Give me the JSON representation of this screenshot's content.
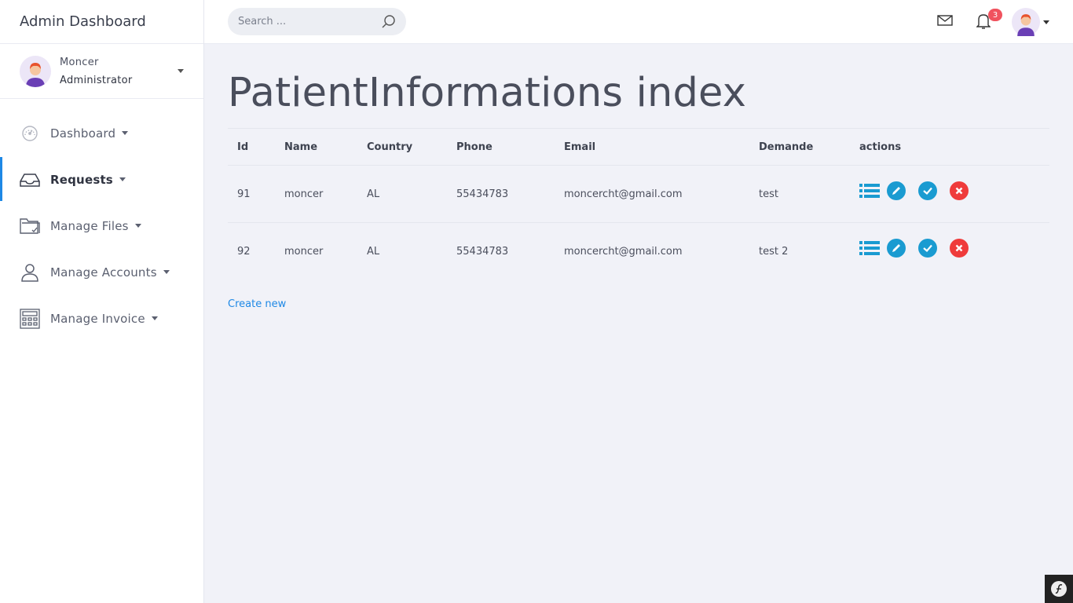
{
  "brand": "Admin Dashboard",
  "user": {
    "name": "Moncer",
    "role": "Administrator"
  },
  "nav": [
    {
      "label": "Dashboard",
      "icon": "speedometer-icon"
    },
    {
      "label": "Requests",
      "icon": "inbox-tray-icon",
      "active": true
    },
    {
      "label": "Manage Files",
      "icon": "folder-check-icon"
    },
    {
      "label": "Manage Accounts",
      "icon": "user-icon"
    },
    {
      "label": "Manage Invoice",
      "icon": "invoice-calculator-icon"
    }
  ],
  "topbar": {
    "search_placeholder": "Search ...",
    "notification_count": "3"
  },
  "page": {
    "title": "PatientInformations index",
    "create_link": "Create new"
  },
  "table": {
    "headers": [
      "Id",
      "Name",
      "Country",
      "Phone",
      "Email",
      "Demande",
      "actions"
    ],
    "rows": [
      {
        "id": "91",
        "name": "moncer",
        "country": "AL",
        "phone": "55434783",
        "email": "moncercht@gmail.com",
        "demande": "test"
      },
      {
        "id": "92",
        "name": "moncer",
        "country": "AL",
        "phone": "55434783",
        "email": "moncercht@gmail.com",
        "demande": "test 2"
      }
    ]
  },
  "colors": {
    "accent": "#1e88e5",
    "action_blue": "#1a9bd1",
    "danger": "#ef3b3b",
    "badge": "#f0525e"
  }
}
